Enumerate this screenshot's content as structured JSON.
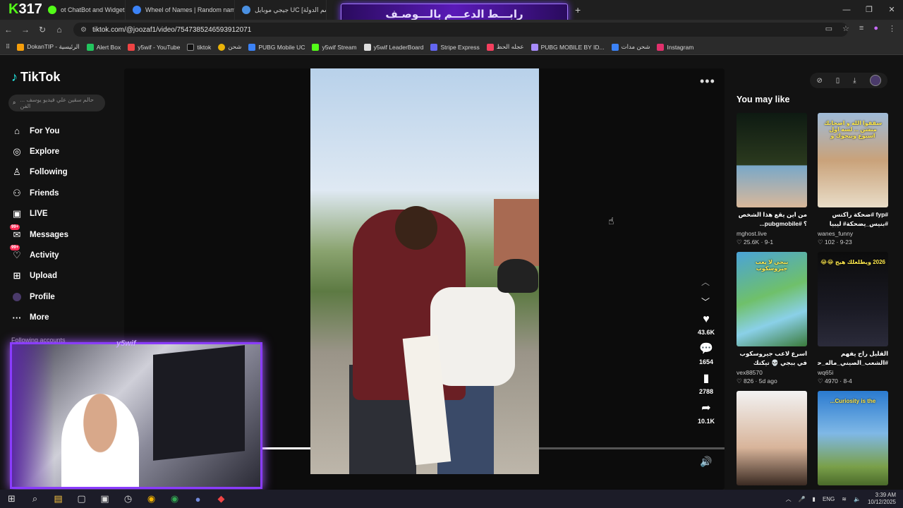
{
  "browser": {
    "tabs": [
      {
        "label": "ot ChatBot and Widgets",
        "color": "#53fc18"
      },
      {
        "label": "Wheel of Names | Random nam",
        "color": "#3b82f6"
      },
      {
        "label": "جيجي موبايل UC [اسم الدولة] | حـ",
        "color": "#4a90e2"
      }
    ],
    "brand_text": "317",
    "brand_k": "K",
    "banner_text": "رابـــط الدعـــم بالـــوصـف",
    "url": "tiktok.com/@joozaf1/video/7547385246593912071",
    "bookmarks": [
      {
        "label": "DokanTIP - الرئيسية",
        "color": "#f59e0b"
      },
      {
        "label": "Alert Box",
        "color": "#22c55e"
      },
      {
        "label": "y5wif - YouTube",
        "color": "#ef4444"
      },
      {
        "label": "tiktok",
        "color": "#111111"
      },
      {
        "label": "شحن",
        "color": "#eab308"
      },
      {
        "label": "PUBG Mobile UC",
        "color": "#3b82f6"
      },
      {
        "label": "y5wif Stream",
        "color": "#53fc18"
      },
      {
        "label": "y5wif LeaderBoard",
        "color": "#dddddd"
      },
      {
        "label": "Stripe Express",
        "color": "#6366f1"
      },
      {
        "label": "عجله الحظ",
        "color": "#f43f5e"
      },
      {
        "label": "PUBG MOBILE BY ID...",
        "color": "#a78bfa"
      },
      {
        "label": "شحن مدات",
        "color": "#3b82f6"
      },
      {
        "label": "Instagram",
        "color": "#e1306c"
      }
    ]
  },
  "tiktok": {
    "logo": "TikTok",
    "search_placeholder": "... حالم سقين علي فيديو يوسف الفن",
    "nav": [
      {
        "label": "For You",
        "icon": "home-icon"
      },
      {
        "label": "Explore",
        "icon": "compass-icon"
      },
      {
        "label": "Following",
        "icon": "following-icon"
      },
      {
        "label": "Friends",
        "icon": "friends-icon"
      },
      {
        "label": "LIVE",
        "icon": "live-icon"
      },
      {
        "label": "Messages",
        "icon": "messages-icon",
        "badge": "99+"
      },
      {
        "label": "Activity",
        "icon": "activity-icon",
        "badge": "99+"
      },
      {
        "label": "Upload",
        "icon": "upload-icon"
      },
      {
        "label": "Profile",
        "icon": "profile-icon"
      },
      {
        "label": "More",
        "icon": "more-icon"
      }
    ],
    "following_accounts": "Following accounts",
    "cam_label": "y5wif",
    "video_progress": 0.11,
    "actions": [
      {
        "name": "like",
        "icon": "heart-icon",
        "count": "43.6K"
      },
      {
        "name": "comment",
        "icon": "comment-icon",
        "count": "1654"
      },
      {
        "name": "save",
        "icon": "bookmark-icon",
        "count": "2788"
      },
      {
        "name": "share",
        "icon": "share-icon",
        "count": "10.1K"
      }
    ],
    "you_may_like": "You may like",
    "recommended": [
      {
        "caption": "من اين يقع هذا الشخص ؟ #pubgmobile...",
        "author": "mghost.live",
        "likes": "25.6K",
        "date": "9-1",
        "bg": "linear-gradient(180deg,#0e1a12 0%,#2b3a1e 55%,#7aa8c8 56%,#d9b89a 100%)",
        "rtl": true
      },
      {
        "caption": "#fyp #ضحكة راكتس #بنيس_يضحكة# ليبيا",
        "author": "wanes_funny",
        "likes": "102",
        "date": "9-23",
        "bg": "linear-gradient(180deg,#9fbbd8 0%,#c9a27a 50%,#e9ddc8 100%)",
        "rtl": true
      },
      {
        "caption": "اسرع لاعب جيروسكوب في ببجي 💀 تيكتك سريمه ...",
        "author": "vex88570",
        "likes": "826",
        "date": "5d ago",
        "bg": "linear-gradient(160deg,#4aa3d8 0%,#6fc06a 45%,#8ad0e8 70%,#3a7a3a 100%)",
        "rtl": true
      },
      {
        "caption": "القليل راح يفهم #الشعب_الصيني_ماله_حل...",
        "author": "wq65i",
        "likes": "4970",
        "date": "8-4",
        "bg": "linear-gradient(180deg,#0c0c0c 0%,#1a1a24 60%,#2b2b3a 100%)",
        "rtl": true
      },
      {
        "caption": "",
        "author": "",
        "likes": "",
        "date": "",
        "bg": "linear-gradient(180deg,#f2f2f2 0%,#d8b49a 60%,#3a2a22 100%)",
        "rtl": true
      },
      {
        "caption": "",
        "author": "",
        "likes": "",
        "date": "",
        "bg": "linear-gradient(180deg,#2a7ad0 0%,#7fb8e6 45%,#7aa04a 80%,#4a6a2a 100%)",
        "rtl": true
      }
    ],
    "thumb_texts": [
      "",
      "سقفوا الله و اصحابك منشن ... لسه اول اسبوع وبيجوك و",
      "ببجي لا يعب جيروسكوب",
      "2026 ويطلعلك هيج 😂😂",
      "",
      "Curiosity is the..."
    ]
  },
  "taskbar": {
    "lang": "ENG",
    "time": "3:39 AM",
    "date": "10/12/2025"
  }
}
